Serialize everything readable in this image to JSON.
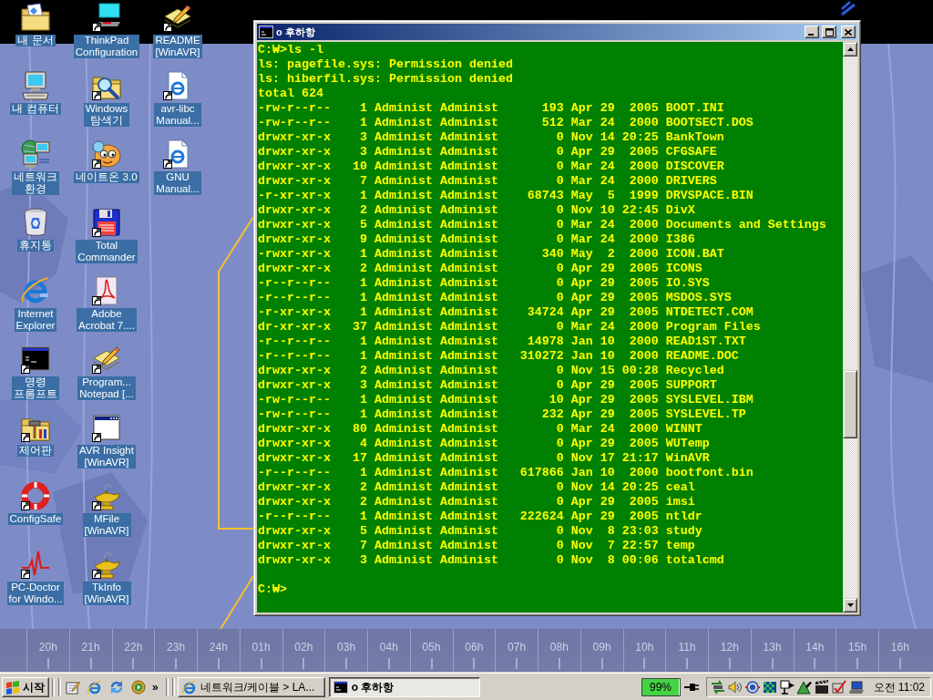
{
  "desktop": {
    "icons": [
      {
        "label": "내 문서",
        "kind": "documents",
        "shortcut": false
      },
      {
        "label": "내 컴퓨터",
        "kind": "computer",
        "shortcut": false
      },
      {
        "label": "네트워크\n환경",
        "kind": "network",
        "shortcut": false
      },
      {
        "label": "휴지통",
        "kind": "trash",
        "shortcut": false
      },
      {
        "label": "Internet\nExplorer",
        "kind": "browser",
        "shortcut": false
      },
      {
        "label": "명령\n프롬프트",
        "kind": "console",
        "shortcut": true
      },
      {
        "label": "제어판",
        "kind": "controlpanel",
        "shortcut": true
      },
      {
        "label": "ConfigSafe",
        "kind": "lifebuoy",
        "shortcut": true
      },
      {
        "label": "PC-Doctor\nfor Windo...",
        "kind": "pulse",
        "shortcut": true
      },
      {
        "label": "ThinkPad\nConfiguration",
        "kind": "display",
        "shortcut": true
      },
      {
        "label": "Windows\n탐색기",
        "kind": "explorer",
        "shortcut": true
      },
      {
        "label": "네이트온 3.0",
        "kind": "messenger",
        "shortcut": true
      },
      {
        "label": "Total\nCommander",
        "kind": "floppy",
        "shortcut": true
      },
      {
        "label": "Adobe\nAcrobat 7....",
        "kind": "pdf",
        "shortcut": true
      },
      {
        "label": "Program...\nNotepad [...",
        "kind": "notepad",
        "shortcut": true
      },
      {
        "label": "AVR Insight\n[WinAVR]",
        "kind": "window",
        "shortcut": true
      },
      {
        "label": "MFile\n[WinAVR]",
        "kind": "lamp",
        "shortcut": true
      },
      {
        "label": "TkInfo\n[WinAVR]",
        "kind": "lamp",
        "shortcut": true
      },
      {
        "label": "README\n[WinAVR]",
        "kind": "notepad",
        "shortcut": true
      },
      {
        "label": "avr-libc\nManual...",
        "kind": "webpage",
        "shortcut": true
      },
      {
        "label": "GNU\nManual...",
        "kind": "webpage",
        "shortcut": true
      }
    ],
    "hour_labels": [
      "20h",
      "21h",
      "22h",
      "23h",
      "24h",
      "01h",
      "02h",
      "03h",
      "04h",
      "05h",
      "06h",
      "07h",
      "08h",
      "09h",
      "10h",
      "11h",
      "12h",
      "13h",
      "14h",
      "15h",
      "16h"
    ]
  },
  "console_window": {
    "title": "o 후하항",
    "lines": [
      "C:₩>ls -l",
      "ls: pagefile.sys: Permission denied",
      "ls: hiberfil.sys: Permission denied",
      "total 624"
    ],
    "listing": [
      {
        "permissions": "-rw-r--r--",
        "links": "1",
        "owner": "Administ",
        "group": "Administ",
        "size": "193",
        "date": "Apr 29  2005",
        "name": "BOOT.INI"
      },
      {
        "permissions": "-rw-r--r--",
        "links": "1",
        "owner": "Administ",
        "group": "Administ",
        "size": "512",
        "date": "Mar 24  2000",
        "name": "BOOTSECT.DOS"
      },
      {
        "permissions": "drwxr-xr-x",
        "links": "3",
        "owner": "Administ",
        "group": "Administ",
        "size": "0",
        "date": "Nov 14 20:25",
        "name": "BankTown"
      },
      {
        "permissions": "drwxr-xr-x",
        "links": "3",
        "owner": "Administ",
        "group": "Administ",
        "size": "0",
        "date": "Apr 29  2005",
        "name": "CFGSAFE"
      },
      {
        "permissions": "drwxr-xr-x",
        "links": "10",
        "owner": "Administ",
        "group": "Administ",
        "size": "0",
        "date": "Mar 24  2000",
        "name": "DISCOVER"
      },
      {
        "permissions": "drwxr-xr-x",
        "links": "7",
        "owner": "Administ",
        "group": "Administ",
        "size": "0",
        "date": "Mar 24  2000",
        "name": "DRIVERS"
      },
      {
        "permissions": "-r-xr-xr-x",
        "links": "1",
        "owner": "Administ",
        "group": "Administ",
        "size": "68743",
        "date": "May  5  1999",
        "name": "DRVSPACE.BIN"
      },
      {
        "permissions": "drwxr-xr-x",
        "links": "2",
        "owner": "Administ",
        "group": "Administ",
        "size": "0",
        "date": "Nov 10 22:45",
        "name": "DivX"
      },
      {
        "permissions": "drwxr-xr-x",
        "links": "5",
        "owner": "Administ",
        "group": "Administ",
        "size": "0",
        "date": "Mar 24  2000",
        "name": "Documents and Settings"
      },
      {
        "permissions": "drwxr-xr-x",
        "links": "9",
        "owner": "Administ",
        "group": "Administ",
        "size": "0",
        "date": "Mar 24  2000",
        "name": "I386"
      },
      {
        "permissions": "-rwxr-xr-x",
        "links": "1",
        "owner": "Administ",
        "group": "Administ",
        "size": "340",
        "date": "May  2  2000",
        "name": "ICON.BAT"
      },
      {
        "permissions": "drwxr-xr-x",
        "links": "2",
        "owner": "Administ",
        "group": "Administ",
        "size": "0",
        "date": "Apr 29  2005",
        "name": "ICONS"
      },
      {
        "permissions": "-r--r--r--",
        "links": "1",
        "owner": "Administ",
        "group": "Administ",
        "size": "0",
        "date": "Apr 29  2005",
        "name": "IO.SYS"
      },
      {
        "permissions": "-r--r--r--",
        "links": "1",
        "owner": "Administ",
        "group": "Administ",
        "size": "0",
        "date": "Apr 29  2005",
        "name": "MSDOS.SYS"
      },
      {
        "permissions": "-r-xr-xr-x",
        "links": "1",
        "owner": "Administ",
        "group": "Administ",
        "size": "34724",
        "date": "Apr 29  2005",
        "name": "NTDETECT.COM"
      },
      {
        "permissions": "dr-xr-xr-x",
        "links": "37",
        "owner": "Administ",
        "group": "Administ",
        "size": "0",
        "date": "Mar 24  2000",
        "name": "Program Files"
      },
      {
        "permissions": "-r--r--r--",
        "links": "1",
        "owner": "Administ",
        "group": "Administ",
        "size": "14978",
        "date": "Jan 10  2000",
        "name": "READ1ST.TXT"
      },
      {
        "permissions": "-r--r--r--",
        "links": "1",
        "owner": "Administ",
        "group": "Administ",
        "size": "310272",
        "date": "Jan 10  2000",
        "name": "README.DOC"
      },
      {
        "permissions": "drwxr-xr-x",
        "links": "2",
        "owner": "Administ",
        "group": "Administ",
        "size": "0",
        "date": "Nov 15 00:28",
        "name": "Recycled"
      },
      {
        "permissions": "drwxr-xr-x",
        "links": "3",
        "owner": "Administ",
        "group": "Administ",
        "size": "0",
        "date": "Apr 29  2005",
        "name": "SUPPORT"
      },
      {
        "permissions": "-rw-r--r--",
        "links": "1",
        "owner": "Administ",
        "group": "Administ",
        "size": "10",
        "date": "Apr 29  2005",
        "name": "SYSLEVEL.IBM"
      },
      {
        "permissions": "-rw-r--r--",
        "links": "1",
        "owner": "Administ",
        "group": "Administ",
        "size": "232",
        "date": "Apr 29  2005",
        "name": "SYSLEVEL.TP"
      },
      {
        "permissions": "drwxr-xr-x",
        "links": "80",
        "owner": "Administ",
        "group": "Administ",
        "size": "0",
        "date": "Mar 24  2000",
        "name": "WINNT"
      },
      {
        "permissions": "drwxr-xr-x",
        "links": "4",
        "owner": "Administ",
        "group": "Administ",
        "size": "0",
        "date": "Apr 29  2005",
        "name": "WUTemp"
      },
      {
        "permissions": "drwxr-xr-x",
        "links": "17",
        "owner": "Administ",
        "group": "Administ",
        "size": "0",
        "date": "Nov 17 21:17",
        "name": "WinAVR"
      },
      {
        "permissions": "-r--r--r--",
        "links": "1",
        "owner": "Administ",
        "group": "Administ",
        "size": "617866",
        "date": "Jan 10  2000",
        "name": "bootfont.bin"
      },
      {
        "permissions": "drwxr-xr-x",
        "links": "2",
        "owner": "Administ",
        "group": "Administ",
        "size": "0",
        "date": "Nov 14 20:25",
        "name": "ceal"
      },
      {
        "permissions": "drwxr-xr-x",
        "links": "2",
        "owner": "Administ",
        "group": "Administ",
        "size": "0",
        "date": "Apr 29  2005",
        "name": "imsi"
      },
      {
        "permissions": "-r--r--r--",
        "links": "1",
        "owner": "Administ",
        "group": "Administ",
        "size": "222624",
        "date": "Apr 29  2005",
        "name": "ntldr"
      },
      {
        "permissions": "drwxr-xr-x",
        "links": "5",
        "owner": "Administ",
        "group": "Administ",
        "size": "0",
        "date": "Nov  8 23:03",
        "name": "study"
      },
      {
        "permissions": "drwxr-xr-x",
        "links": "7",
        "owner": "Administ",
        "group": "Administ",
        "size": "0",
        "date": "Nov  7 22:57",
        "name": "temp"
      },
      {
        "permissions": "drwxr-xr-x",
        "links": "3",
        "owner": "Administ",
        "group": "Administ",
        "size": "0",
        "date": "Nov  8 00:06",
        "name": "totalcmd"
      }
    ],
    "prompt": "C:₩>"
  },
  "taskbar": {
    "start": "시작",
    "quick_launch": [
      {
        "kind": "notepad"
      },
      {
        "kind": "browser"
      },
      {
        "kind": "sync"
      },
      {
        "kind": "player"
      }
    ],
    "more": "»",
    "tasks": [
      {
        "label": "네트워크/케이블 > LA...",
        "kind": "browser",
        "selected": false
      },
      {
        "label": "o 후하항",
        "kind": "console",
        "selected": true
      }
    ],
    "battery": {
      "reading": "99%",
      "level": 0.99
    },
    "tray_icons": [
      {
        "kind": "arrows"
      },
      {
        "kind": "speaker"
      },
      {
        "kind": "target"
      },
      {
        "kind": "checker"
      },
      {
        "kind": "signpost"
      },
      {
        "kind": "triangle"
      },
      {
        "kind": "clapper"
      },
      {
        "kind": "check"
      },
      {
        "kind": "laptop"
      }
    ],
    "clock": "오전 11:02"
  }
}
